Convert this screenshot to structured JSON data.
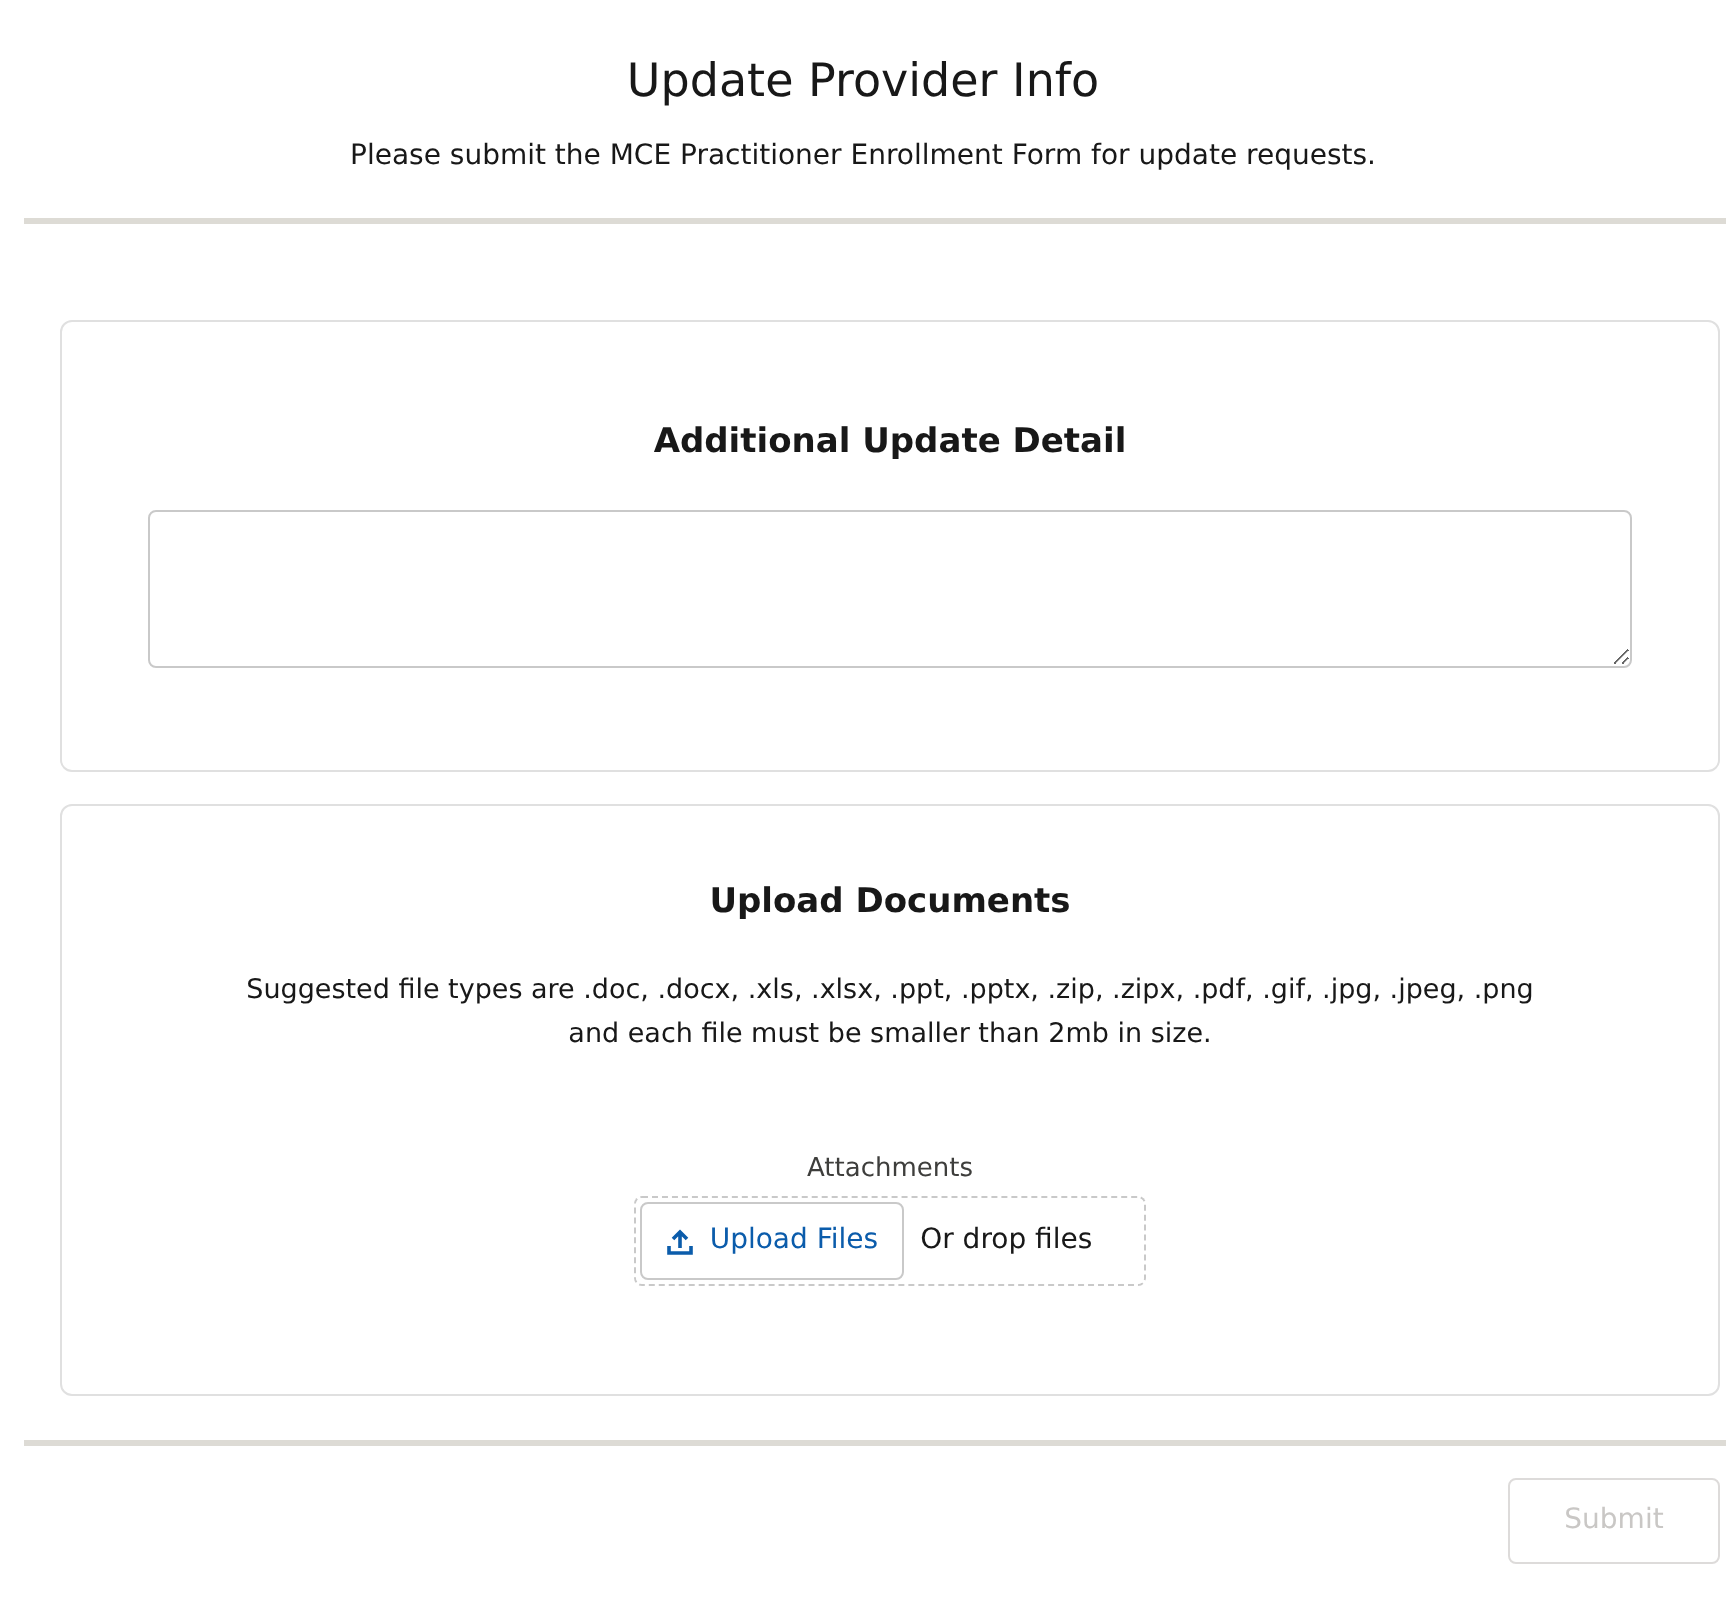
{
  "title": "Update Provider Info",
  "subtitle": "Please submit the MCE Practitioner Enrollment Form for update requests.",
  "detail_section": {
    "heading": "Additional Update Detail"
  },
  "upload_section": {
    "heading": "Upload Documents",
    "note_line_1": "Suggested file types are .doc, .docx, .xls, .xlsx, .ppt, .pptx, .zip, .zipx, .pdf, .gif, .jpg, .jpeg, .png",
    "note_line_2": "and each file must be smaller than 2mb in size.",
    "field_label": "Attachments",
    "upload_button": "Upload Files",
    "drop_text": "Or drop files"
  },
  "submit_button": {
    "label": "Submit",
    "disabled": true
  }
}
